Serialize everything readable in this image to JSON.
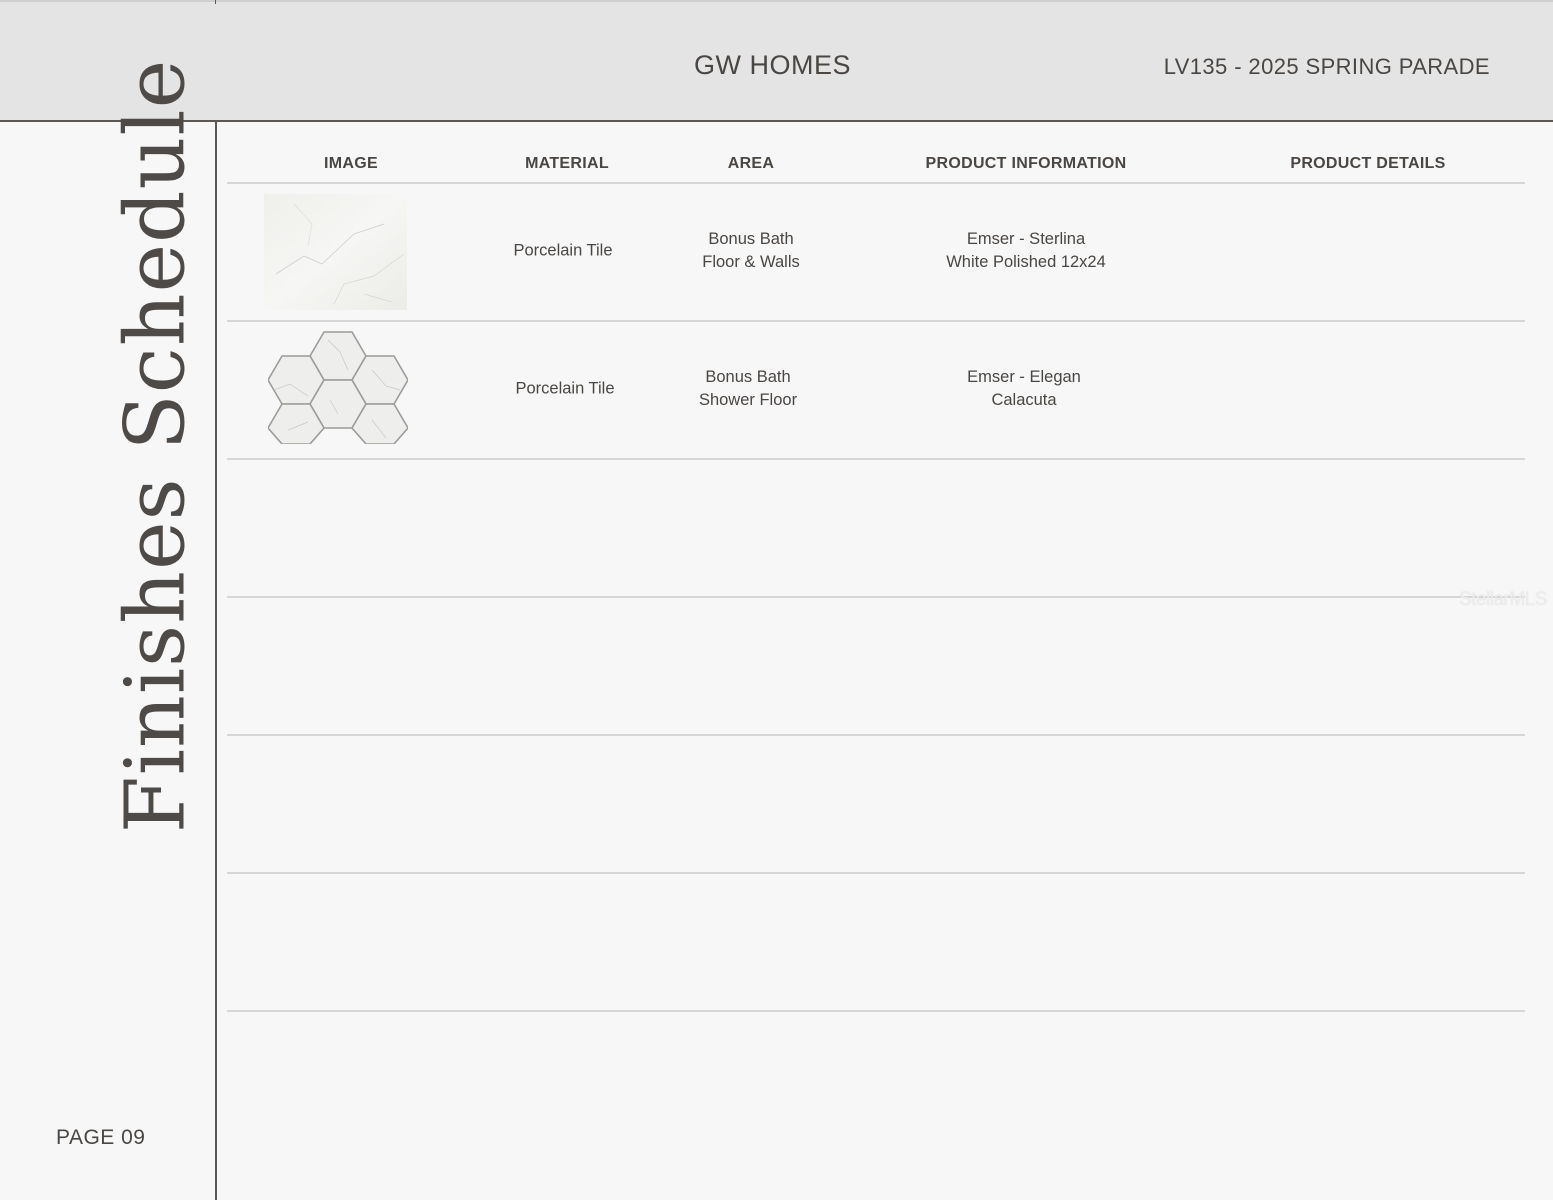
{
  "header": {
    "brand": "GW HOMES",
    "project": "LV135 - 2025 SPRING PARADE"
  },
  "sidebar": {
    "title": "Finishes Schedule",
    "page": "PAGE 09"
  },
  "table": {
    "columns": [
      "IMAGE",
      "MATERIAL",
      "AREA",
      "PRODUCT INFORMATION",
      "PRODUCT DETAILS"
    ],
    "rows": [
      {
        "image": "white-marble-slab-tile",
        "material": "Porcelain Tile",
        "area_line1": "Bonus Bath",
        "area_line2": "Floor & Walls",
        "info_line1": "Emser - Sterlina",
        "info_line2": "White Polished 12x24",
        "details": ""
      },
      {
        "image": "hexagon-mosaic-tile",
        "material": "Porcelain Tile",
        "area_line1": "Bonus Bath",
        "area_line2": "Shower Floor",
        "info_line1": "Emser - Elegan",
        "info_line2": "Calacuta",
        "details": ""
      }
    ]
  },
  "watermark": "StellarMLS",
  "colors": {
    "header_bg": "#e4e4e4",
    "page_bg": "#f7f7f7",
    "text": "#4a4643",
    "rule": "#d6d6d6"
  }
}
